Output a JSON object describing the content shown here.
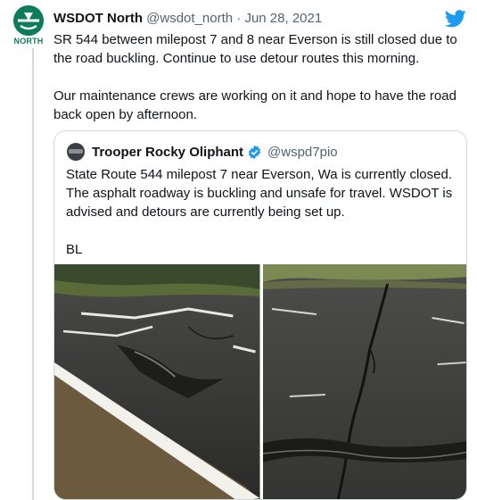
{
  "tweet": {
    "author_name": "WSDOT North",
    "author_handle": "@wsdot_north",
    "separator": " · ",
    "date": "Jun 28, 2021",
    "avatar_caption": "NORTH",
    "paragraphs": [
      "SR 544 between milepost 7 and 8 near Everson is still closed due to the road buckling. Continue to use detour routes this morning.",
      "Our maintenance crews are working on it and hope to have the road back open by afternoon."
    ]
  },
  "quoted_tweet": {
    "author_name": "Trooper Rocky Oliphant",
    "author_handle": "@wspd7pio",
    "paragraphs": [
      "State Route 544 milepost 7 near Everson, Wa is currently closed. The asphalt roadway is buckling and unsafe for travel. WSDOT is advised and detours are currently being set up.",
      "BL"
    ],
    "photos": [
      {
        "name": "buckled-road-photo-left",
        "icon": "photo"
      },
      {
        "name": "cracked-road-photo-right",
        "icon": "photo"
      }
    ]
  },
  "icons": {
    "platform": "twitter-bird-icon",
    "verified": "verified-badge-icon"
  },
  "colors": {
    "brand_blue": "#1d9bf0",
    "wsdot_green": "#0c7c59",
    "text_primary": "#0f1419",
    "text_secondary": "#536471",
    "border": "#cfd9de"
  }
}
